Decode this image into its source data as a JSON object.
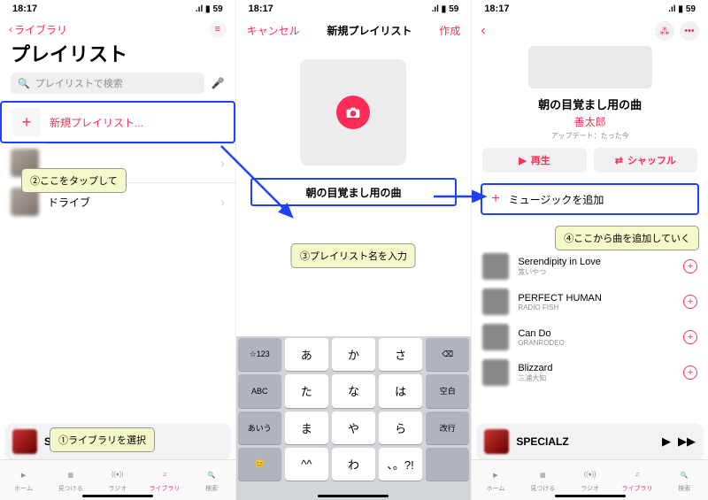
{
  "status": {
    "time": "18:17",
    "signal": "􀙇",
    "wifi": "􀙈",
    "battery": "59"
  },
  "p1": {
    "back_label": "ライブラリ",
    "title": "プレイリスト",
    "search_placeholder": "プレイリストで検索",
    "new_playlist": "新規プレイリスト...",
    "items": [
      {
        "label": ""
      },
      {
        "label": "ドライブ"
      }
    ],
    "miniplayer_track": "SPE",
    "tabs": [
      "ホーム",
      "見つける",
      "ラジオ",
      "ライブラリ",
      "検索"
    ],
    "callout2": "②ここをタップして",
    "callout1": "①ライブラリを選択"
  },
  "p2": {
    "cancel": "キャンセル",
    "title": "新規プレイリスト",
    "create": "作成",
    "playlist_name": "朝の目覚まし用の曲",
    "callout3": "③プレイリスト名を入力",
    "keys_r1": [
      "☆123",
      "あ",
      "か",
      "さ",
      "⌫"
    ],
    "keys_r2": [
      "ABC",
      "た",
      "な",
      "は",
      "空白"
    ],
    "keys_r3": [
      "あいう",
      "ま",
      "や",
      "ら",
      "改行"
    ],
    "keys_r4": [
      "😊",
      "^^",
      "わ",
      "、。?!",
      ""
    ]
  },
  "p3": {
    "title": "朝の目覚まし用の曲",
    "author": "善太郎",
    "updated": "アップデート：たった今",
    "play": "再生",
    "shuffle": "シャッフル",
    "add_music": "ミュージックを追加",
    "callout4": "④ここから曲を追加していく",
    "songs": [
      {
        "t": "Serendipity in Love",
        "a": "笈いやつ"
      },
      {
        "t": "PERFECT HUMAN",
        "a": "RADIO FISH"
      },
      {
        "t": "Can Do",
        "a": "GRANRODEO"
      },
      {
        "t": "Blizzard",
        "a": "三浦大知"
      }
    ],
    "miniplayer_track": "SPECIALZ",
    "tabs": [
      "ホーム",
      "見つける",
      "ラジオ",
      "ライブラリ",
      "検索"
    ]
  }
}
